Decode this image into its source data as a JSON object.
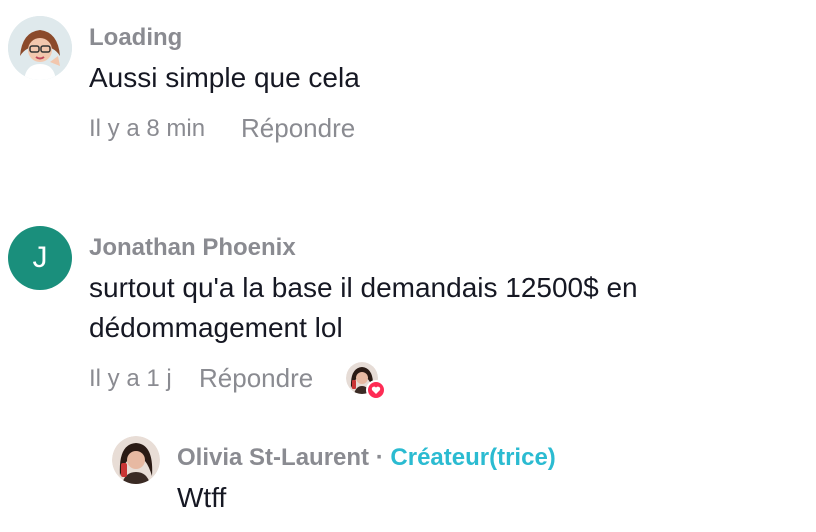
{
  "comments": [
    {
      "author": "Loading",
      "text": "Aussi simple que cela",
      "time": "Il y a 8 min",
      "reply_label": "Répondre"
    },
    {
      "author": "Jonathan Phoenix",
      "avatar_letter": "J",
      "text_line1": "surtout qu'a la base il demandais 12500$ en",
      "text_line2": "dédommagement lol",
      "time": "Il y a 1 j",
      "reply_label": "Répondre"
    }
  ],
  "reply": {
    "author": "Olivia St-Laurent",
    "separator": "·",
    "badge": "Créateur(trice)",
    "text": "Wtff"
  },
  "colors": {
    "muted": "#8a8b91",
    "creator_accent": "#2bbbd1",
    "avatar_green": "#1a8f7c",
    "like_red": "#fe2c55"
  }
}
